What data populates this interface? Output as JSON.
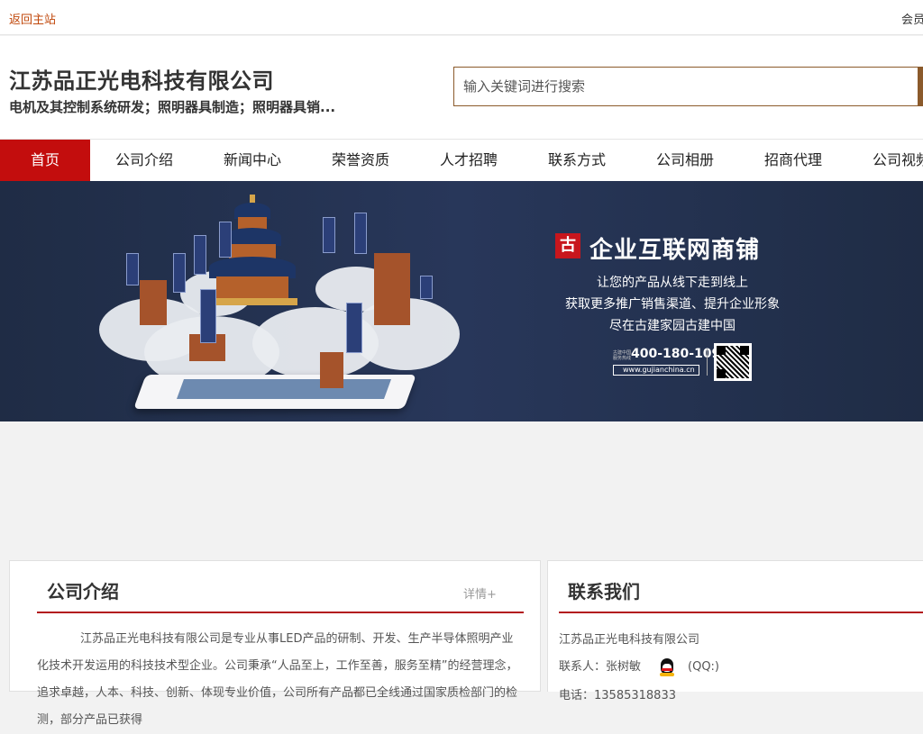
{
  "topbar": {
    "back_label": "返回主站",
    "member_label": "会员"
  },
  "header": {
    "company_name": "江苏品正光电科技有限公司",
    "description": "电机及其控制系统研发；照明器具制造；照明器具销...",
    "search_placeholder": "输入关键词进行搜索"
  },
  "nav": {
    "items": [
      {
        "label": "首页"
      },
      {
        "label": "公司介绍"
      },
      {
        "label": "新闻中心"
      },
      {
        "label": "荣誉资质"
      },
      {
        "label": "人才招聘"
      },
      {
        "label": "联系方式"
      },
      {
        "label": "公司相册"
      },
      {
        "label": "招商代理"
      },
      {
        "label": "公司视频"
      }
    ]
  },
  "banner": {
    "logo_char": "古",
    "title": "企业互联网商铺",
    "slogan_1": "让您的产品从线下走到线上",
    "slogan_2": "获取更多推广销售渠道、提升企业形象",
    "slogan_3": "尽在古建家园古建中国",
    "hotline_label": "古建中国服务热线",
    "hotline": "400-180-1090",
    "site_url": "www.gujianchina.cn"
  },
  "intro": {
    "title": "公司介绍",
    "more_label": "详情+",
    "text": "江苏品正光电科技有限公司是专业从事LED产品的研制、开发、生产半导体照明产业化技术开发运用的科技技术型企业。公司秉承“人品至上，工作至善，服务至精”的经营理念，追求卓越，人本、科技、创新、体现专业价值，公司所有产品都已全线通过国家质检部门的检测，部分产品已获得"
  },
  "contact": {
    "title": "联系我们",
    "company": "江苏品正光电科技有限公司",
    "person": "联系人：张树敏",
    "qq": "(QQ:)",
    "phone": "电话：13585318833"
  }
}
